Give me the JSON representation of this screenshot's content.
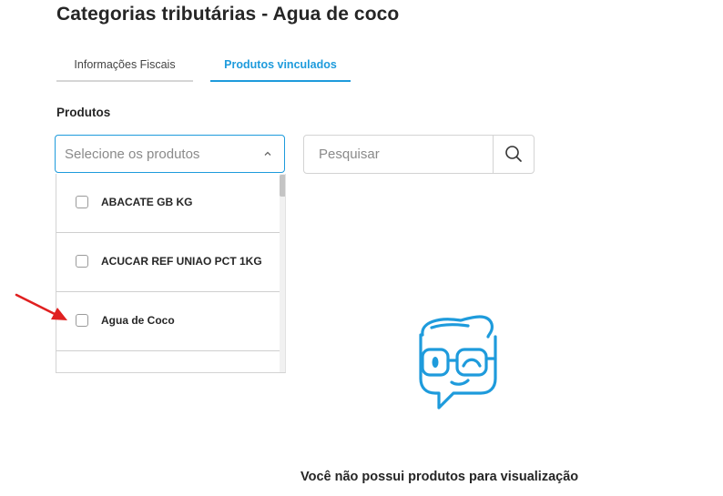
{
  "page": {
    "title": "Categorias tributárias - Agua de coco"
  },
  "tabs": [
    {
      "label": "Informações Fiscais",
      "active": false
    },
    {
      "label": "Produtos vinculados",
      "active": true
    }
  ],
  "products_section": {
    "label": "Produtos",
    "select_placeholder": "Selecione os produtos"
  },
  "search": {
    "placeholder": "Pesquisar"
  },
  "dropdown": {
    "options": [
      {
        "label": "ABACATE GB KG",
        "checked": false
      },
      {
        "label": "ACUCAR REF UNIAO PCT 1KG",
        "checked": false
      },
      {
        "label": "Agua de Coco",
        "checked": false
      }
    ]
  },
  "empty_state": {
    "message": "Você não possui produtos para visualização"
  },
  "colors": {
    "accent": "#1e9bdc",
    "annotation_arrow": "#e02020",
    "text": "#262626"
  },
  "icons": {
    "select": "chevron-up-icon",
    "search": "magnifier-icon",
    "empty": "nerd-face-chat-bubble-icon",
    "annotation": "red-arrow-icon"
  }
}
